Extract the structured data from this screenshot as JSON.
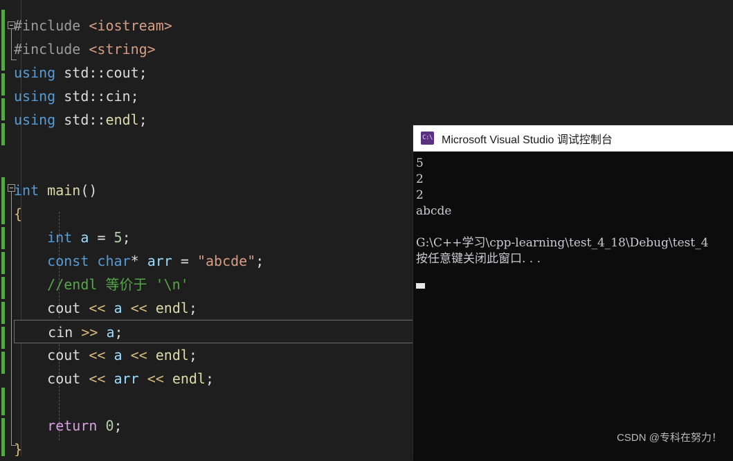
{
  "editor": {
    "name": "visual-studio-code-editor",
    "background": "#1e1e1e",
    "lines": [
      {
        "indent": 0,
        "segments": [
          {
            "cls": "t-pp",
            "text": "#include "
          },
          {
            "cls": "t-inc",
            "text": "<iostream>"
          }
        ]
      },
      {
        "indent": 0,
        "segments": [
          {
            "cls": "t-pp",
            "text": "#include "
          },
          {
            "cls": "t-inc",
            "text": "<string>"
          }
        ]
      },
      {
        "indent": 0,
        "segments": [
          {
            "cls": "t-kw",
            "text": "using "
          },
          {
            "cls": "t-ns",
            "text": "std"
          },
          {
            "cls": "t-op",
            "text": "::"
          },
          {
            "cls": "t-plain",
            "text": "cout"
          },
          {
            "cls": "t-op",
            "text": ";"
          }
        ]
      },
      {
        "indent": 0,
        "segments": [
          {
            "cls": "t-kw",
            "text": "using "
          },
          {
            "cls": "t-ns",
            "text": "std"
          },
          {
            "cls": "t-op",
            "text": "::"
          },
          {
            "cls": "t-plain",
            "text": "cin"
          },
          {
            "cls": "t-op",
            "text": ";"
          }
        ]
      },
      {
        "indent": 0,
        "segments": [
          {
            "cls": "t-kw",
            "text": "using "
          },
          {
            "cls": "t-ns",
            "text": "std"
          },
          {
            "cls": "t-op",
            "text": "::"
          },
          {
            "cls": "t-macro",
            "text": "endl"
          },
          {
            "cls": "t-op",
            "text": ";"
          }
        ]
      },
      {
        "indent": 0,
        "segments": []
      },
      {
        "indent": 0,
        "segments": []
      },
      {
        "indent": 0,
        "segments": [
          {
            "cls": "t-kw",
            "text": "int "
          },
          {
            "cls": "t-fn",
            "text": "main"
          },
          {
            "cls": "t-op",
            "text": "()"
          }
        ]
      },
      {
        "indent": 0,
        "segments": [
          {
            "cls": "t-brace",
            "text": "{"
          }
        ]
      },
      {
        "indent": 4,
        "segments": [
          {
            "cls": "t-kw",
            "text": "int "
          },
          {
            "cls": "t-var",
            "text": "a "
          },
          {
            "cls": "t-op",
            "text": "= "
          },
          {
            "cls": "t-num",
            "text": "5"
          },
          {
            "cls": "t-op",
            "text": ";"
          }
        ]
      },
      {
        "indent": 4,
        "segments": [
          {
            "cls": "t-kw",
            "text": "const "
          },
          {
            "cls": "t-kw",
            "text": "char"
          },
          {
            "cls": "t-op",
            "text": "* "
          },
          {
            "cls": "t-var",
            "text": "arr "
          },
          {
            "cls": "t-op",
            "text": "= "
          },
          {
            "cls": "t-str",
            "text": "\"abcde\""
          },
          {
            "cls": "t-op",
            "text": ";"
          }
        ]
      },
      {
        "indent": 4,
        "segments": [
          {
            "cls": "t-comment",
            "text": "//endl 等价于 '\\n'"
          }
        ]
      },
      {
        "indent": 4,
        "segments": [
          {
            "cls": "t-plain",
            "text": "cout "
          },
          {
            "cls": "t-brace",
            "text": "<< "
          },
          {
            "cls": "t-var",
            "text": "a "
          },
          {
            "cls": "t-brace",
            "text": "<< "
          },
          {
            "cls": "t-macro",
            "text": "endl"
          },
          {
            "cls": "t-op",
            "text": ";"
          }
        ]
      },
      {
        "indent": 4,
        "current": true,
        "segments": [
          {
            "cls": "t-plain",
            "text": "cin "
          },
          {
            "cls": "t-brace",
            "text": ">> "
          },
          {
            "cls": "t-var",
            "text": "a"
          },
          {
            "cls": "t-op",
            "text": ";"
          }
        ]
      },
      {
        "indent": 4,
        "segments": [
          {
            "cls": "t-plain",
            "text": "cout "
          },
          {
            "cls": "t-brace",
            "text": "<< "
          },
          {
            "cls": "t-var",
            "text": "a "
          },
          {
            "cls": "t-brace",
            "text": "<< "
          },
          {
            "cls": "t-macro",
            "text": "endl"
          },
          {
            "cls": "t-op",
            "text": ";"
          }
        ]
      },
      {
        "indent": 4,
        "segments": [
          {
            "cls": "t-plain",
            "text": "cout "
          },
          {
            "cls": "t-brace",
            "text": "<< "
          },
          {
            "cls": "t-var",
            "text": "arr "
          },
          {
            "cls": "t-brace",
            "text": "<< "
          },
          {
            "cls": "t-macro",
            "text": "endl"
          },
          {
            "cls": "t-op",
            "text": ";"
          }
        ]
      },
      {
        "indent": 4,
        "segments": []
      },
      {
        "indent": 4,
        "segments": [
          {
            "cls": "t-ctl",
            "text": "return "
          },
          {
            "cls": "t-num",
            "text": "0"
          },
          {
            "cls": "t-op",
            "text": ";"
          }
        ]
      },
      {
        "indent": 0,
        "segments": [
          {
            "cls": "t-brace",
            "text": "}"
          }
        ]
      }
    ]
  },
  "console": {
    "title": "Microsoft Visual Studio 调试控制台",
    "icon_label": "C:\\",
    "output": [
      "5",
      "2",
      "2",
      "abcde",
      "",
      "G:\\C++学习\\cpp-learning\\test_4_18\\Debug\\test_4",
      "按任意键关闭此窗口. . ."
    ]
  },
  "watermark": {
    "text": "CSDN @专科在努力！"
  }
}
